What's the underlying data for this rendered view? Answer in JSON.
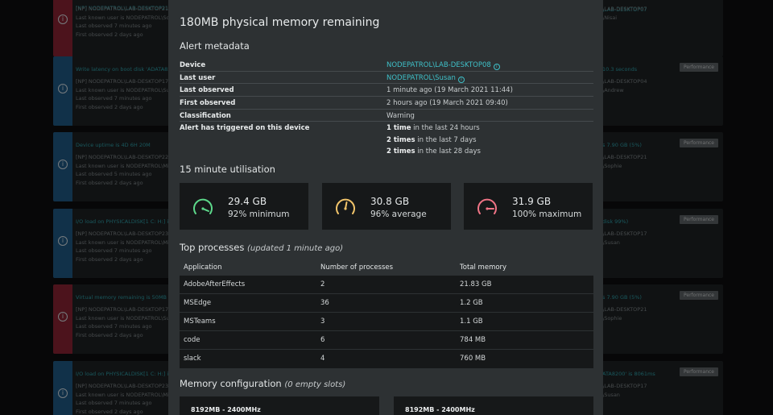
{
  "modal": {
    "title": "180MB physical memory remaining",
    "alert_metadata": {
      "heading": "Alert metadata",
      "rows": [
        {
          "label": "Device",
          "value": "NODEPATROL\\LAB-DESKTOP08",
          "link": true
        },
        {
          "label": "Last user",
          "value": "NODEPATROL\\Susan",
          "link": true
        },
        {
          "label": "Last observed",
          "value": "1 minute ago (19 March 2021 11:44)",
          "link": false
        },
        {
          "label": "First observed",
          "value": "2 hours ago (19 March 2021 09:40)",
          "link": false
        },
        {
          "label": "Classification",
          "value": "Warning",
          "link": false
        }
      ],
      "triggered": {
        "label": "Alert has triggered on this device",
        "lines": [
          {
            "count": "1 time",
            "rest": " in the last 24 hours"
          },
          {
            "count": "2 times",
            "rest": " in the last 7 days"
          },
          {
            "count": "2 times",
            "rest": " in the last 28 days"
          }
        ]
      }
    },
    "utilisation": {
      "heading": "15 minute utilisation",
      "cards": [
        {
          "value": "29.4 GB",
          "label": "92% minimum",
          "color": "#5cd88a"
        },
        {
          "value": "30.8 GB",
          "label": "96% average",
          "color": "#f2c46a"
        },
        {
          "value": "31.9 GB",
          "label": "100% maximum",
          "color": "#f07486"
        }
      ]
    },
    "processes": {
      "heading": "Top processes",
      "subheading": "(updated 1 minute ago)",
      "columns": [
        "Application",
        "Number of processes",
        "Total memory"
      ],
      "rows": [
        {
          "app": "AdobeAfterEffects",
          "count": "2",
          "memory": "21.83 GB"
        },
        {
          "app": "MSEdge",
          "count": "36",
          "memory": "1.2 GB"
        },
        {
          "app": "MSTeams",
          "count": "3",
          "memory": "1.1 GB"
        },
        {
          "app": "code",
          "count": "6",
          "memory": "784 MB"
        },
        {
          "app": "slack",
          "count": "4",
          "memory": "760 MB"
        }
      ]
    },
    "memory_config": {
      "heading": "Memory configuration",
      "subheading": "(0 empty slots)",
      "slots": [
        "8192MB - 2400MHz",
        "8192MB - 2400MHz"
      ]
    }
  },
  "background": {
    "left_cards": [
      {
        "strip": "red",
        "title": "[NP] NODEPATROL\\LAB-DESKTOP21",
        "lines": [
          "[NP] NODEPATROL\\LAB-DESKTOP21",
          "Last known user is NODEPATROL\\Sophie",
          "Last observed 7 minutes ago",
          "First observed 2 days ago"
        ]
      },
      {
        "strip": "blue",
        "title": "Write latency on boot disk 'ADATA8200'",
        "lines": [
          "[NP] NODEPATROL\\LAB-DESKTOP17",
          "Last known user is NODEPATROL\\Susan",
          "Last observed 7 minutes ago",
          "First observed 2 days ago"
        ]
      },
      {
        "strip": "blue",
        "title": "Device uptime is 4D 6H 20M",
        "lines": [
          "[NP] NODEPATROL\\LAB-DESKTOP22",
          "Last known user is NODEPATROL\\Michael",
          "Last observed 5 minutes ago",
          "First observed 2 days ago"
        ]
      },
      {
        "strip": "blue",
        "title": "I/O load on PHYSICALDISK[1 C: H:] is 94",
        "lines": [
          "[NP] NODEPATROL\\LAB-DESKTOP23",
          "Last known user is NODEPATROL\\Michael",
          "Last observed 7 minutes ago",
          "First observed 2 days ago"
        ]
      },
      {
        "strip": "red",
        "title": "Virtual memory remaining is 50MB",
        "lines": [
          "[NP] NODEPATROL\\LAB-DESKTOP17",
          "Last known user is NODEPATROL\\Susan",
          "Last observed 7 minutes ago",
          "First observed 2 days ago"
        ]
      },
      {
        "strip": "blue",
        "title": "I/O load on PHYSICALDISK[1 C: H:] is 94",
        "lines": [
          "[NP] NODEPATROL\\LAB-DESKTOP23",
          "Last known user is NODEPATROL\\Michael",
          "Last observed 7 minutes ago",
          "First observed 2 days ago"
        ]
      }
    ],
    "right_cards": [
      {
        "strip": "red",
        "tag": "",
        "title": "\\LAB-DESKTOP07",
        "lines": [
          "\\LAB-DESKTOP07",
          "\\Nisai"
        ]
      },
      {
        "strip": "blue",
        "tag": "Performance",
        "title": "10.3 seconds",
        "lines": [
          "\\LAB-DESKTOP04",
          "\\Andrew"
        ]
      },
      {
        "strip": "blue",
        "tag": "Performance",
        "title": "s 7.90 GB (5%)",
        "lines": [
          "\\LAB-DESKTOP21",
          "\\Sophie"
        ]
      },
      {
        "strip": "blue",
        "tag": "Performance",
        "title": "disk 99%)",
        "lines": [
          "\\LAB-DESKTOP17",
          "\\Susan"
        ]
      },
      {
        "strip": "red",
        "tag": "Performance",
        "title": "s 7.90 GB (5%)",
        "lines": [
          "\\LAB-DESKTOP21",
          "\\Sophie"
        ]
      },
      {
        "strip": "blue",
        "tag": "Performance",
        "title": "ATA8200' is 8061ms",
        "lines": [
          "\\LAB-DESKTOP17",
          "\\Susan"
        ]
      }
    ]
  }
}
